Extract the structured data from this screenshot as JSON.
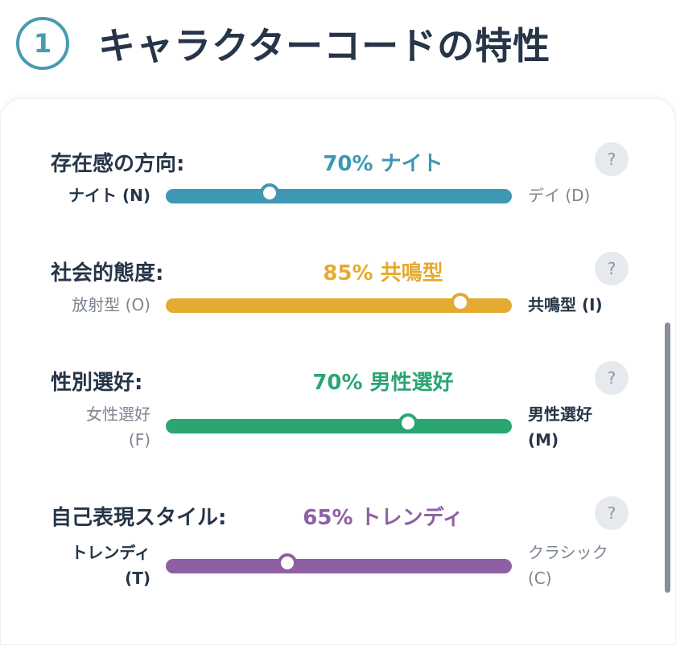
{
  "header": {
    "step": "1",
    "title": "キャラクターコードの特性"
  },
  "help_symbol": "?",
  "traits": [
    {
      "label": "存在感の方向:",
      "value_text": "70% ナイト",
      "left": "ナイト (N)",
      "right": "デイ (D)",
      "strong_side": "left",
      "position": 0.3,
      "color": "#3e97b3"
    },
    {
      "label": "社会的態度:",
      "value_text": "85% 共鳴型",
      "left": "放射型 (O)",
      "right": "共鳴型 (I)",
      "strong_side": "right",
      "position": 0.85,
      "color": "#e5ab30"
    },
    {
      "label": "性別選好:",
      "value_text": "70% 男性選好",
      "left": "女性選好\n(F)",
      "right": "男性選好\n(M)",
      "strong_side": "right",
      "position": 0.7,
      "color": "#2aa673"
    },
    {
      "label": "自己表現スタイル:",
      "value_text": "65% トレンディ",
      "left": "トレンディ\n(T)",
      "right": "クラシック\n(C)",
      "strong_side": "left",
      "position": 0.35,
      "color": "#8f5fa3"
    }
  ]
}
